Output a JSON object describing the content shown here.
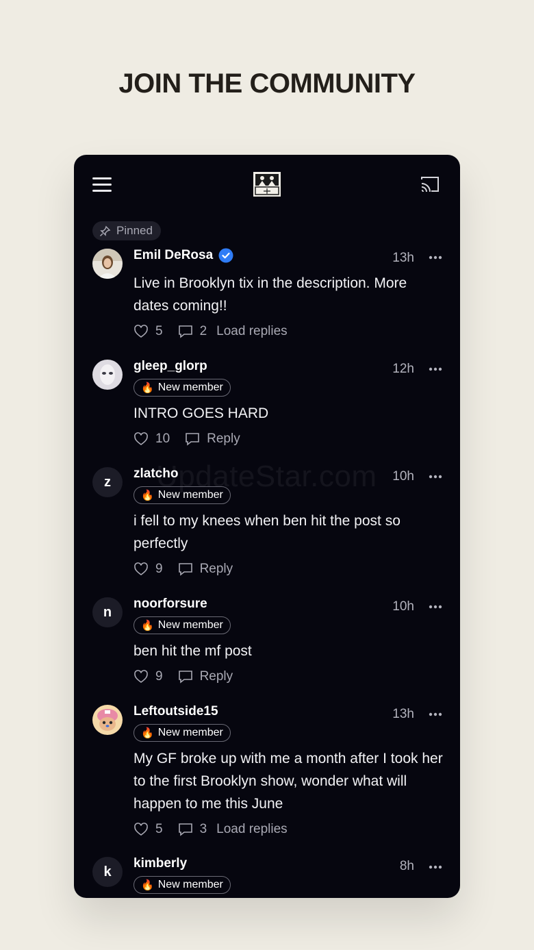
{
  "hero": {
    "title": "JOIN THE COMMUNITY"
  },
  "pinned": {
    "label": "Pinned"
  },
  "watermark": "UpdateStar.com",
  "comments": [
    {
      "user": "Emil DeRosa",
      "verified": true,
      "time": "13h",
      "badge": "",
      "text": "Live in Brooklyn tix in the description. More dates coming!!",
      "likes": "5",
      "replies": "2",
      "reply_label": "Load replies"
    },
    {
      "user": "gleep_glorp",
      "time": "12h",
      "badge": "New member",
      "text": "INTRO GOES HARD",
      "likes": "10",
      "replies": "",
      "reply_label": "Reply"
    },
    {
      "user": "zlatcho",
      "avatar_letter": "z",
      "time": "10h",
      "badge": "New member",
      "text": "i fell to my knees when ben hit the post so perfectly",
      "likes": "9",
      "replies": "",
      "reply_label": "Reply"
    },
    {
      "user": "noorforsure",
      "avatar_letter": "n",
      "time": "10h",
      "badge": "New member",
      "text": "ben hit the mf post",
      "likes": "9",
      "replies": "",
      "reply_label": "Reply"
    },
    {
      "user": "Leftoutside15",
      "time": "13h",
      "badge": "New member",
      "text": "My GF broke up with me a month after I took her to the first Brooklyn show, wonder what will happen to me this June",
      "likes": "5",
      "replies": "3",
      "reply_label": "Load replies"
    },
    {
      "user": "kimberly",
      "avatar_letter": "k",
      "time": "8h",
      "badge": "New member"
    }
  ],
  "colors": {
    "page_bg": "#efece3",
    "panel_bg": "#06060f",
    "verified": "#2f7cf6"
  }
}
